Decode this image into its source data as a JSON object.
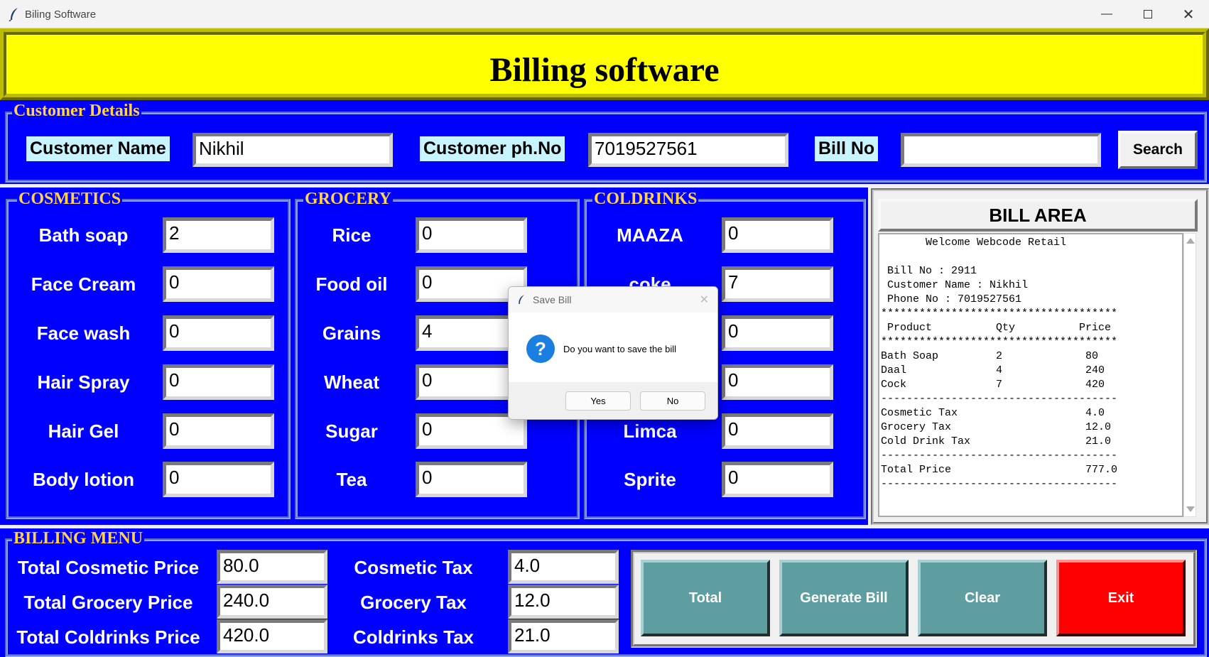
{
  "window": {
    "title": "Biling Software",
    "minimize_icon": "minimize-icon",
    "maximize_icon": "maximize-icon",
    "close_icon": "close-icon"
  },
  "banner": {
    "title": "Billing software"
  },
  "customer": {
    "group_label": "Customer Details",
    "name_label": "Customer Name",
    "name_value": "Nikhil",
    "phone_label": "Customer ph.No",
    "phone_value": "7019527561",
    "billno_label": "Bill No",
    "billno_value": "",
    "search_label": "Search"
  },
  "cosmetics": {
    "group_label": "COSMETICS",
    "items": [
      {
        "label": "Bath soap",
        "value": "2"
      },
      {
        "label": "Face Cream",
        "value": "0"
      },
      {
        "label": "Face wash",
        "value": "0"
      },
      {
        "label": "Hair Spray",
        "value": "0"
      },
      {
        "label": "Hair Gel",
        "value": "0"
      },
      {
        "label": "Body lotion",
        "value": "0"
      }
    ]
  },
  "grocery": {
    "group_label": "GROCERY",
    "items": [
      {
        "label": "Rice",
        "value": "0"
      },
      {
        "label": "Food oil",
        "value": "0"
      },
      {
        "label": "Grains",
        "value": "4"
      },
      {
        "label": "Wheat",
        "value": "0"
      },
      {
        "label": "Sugar",
        "value": "0"
      },
      {
        "label": "Tea",
        "value": "0"
      }
    ]
  },
  "coldrinks": {
    "group_label": "COLDRINKS",
    "items": [
      {
        "label": "MAAZA",
        "value": "0"
      },
      {
        "label": "coke",
        "value": "7"
      },
      {
        "label": "",
        "value": "0"
      },
      {
        "label": "",
        "value": "0"
      },
      {
        "label": "Limca",
        "value": "0"
      },
      {
        "label": "Sprite",
        "value": "0"
      }
    ]
  },
  "bill_area": {
    "title": "BILL AREA",
    "text": "       Welcome Webcode Retail\n\n Bill No : 2911\n Customer Name : Nikhil\n Phone No : 7019527561\n*************************************\n Product          Qty          Price\n*************************************\nBath Soap         2             80\nDaal              4             240\nCock              7             420\n-------------------------------------\nCosmetic Tax                    4.0\nGrocery Tax                     12.0\nCold Drink Tax                  21.0\n-------------------------------------\nTotal Price                     777.0\n-------------------------------------"
  },
  "billing_menu": {
    "group_label": "BILLING MENU",
    "total_cosmetic_label": "Total Cosmetic Price",
    "total_cosmetic_value": "80.0",
    "total_grocery_label": "Total Grocery Price",
    "total_grocery_value": "240.0",
    "total_coldrinks_label": "Total Coldrinks Price",
    "total_coldrinks_value": "420.0",
    "cosmetic_tax_label": "Cosmetic Tax",
    "cosmetic_tax_value": "4.0",
    "grocery_tax_label": "Grocery Tax",
    "grocery_tax_value": "12.0",
    "coldrinks_tax_label": "Coldrinks Tax",
    "coldrinks_tax_value": "21.0",
    "buttons": {
      "total": "Total",
      "generate": "Generate Bill",
      "clear": "Clear",
      "exit": "Exit"
    }
  },
  "dialog": {
    "title": "Save Bill",
    "message": "Do you want to save the bill",
    "icon_glyph": "?",
    "yes": "Yes",
    "no": "No"
  },
  "colors": {
    "banner": "#ffff00",
    "panel": "#0000ff",
    "group_label": "#ffd24a",
    "action_button": "#5f9ea0",
    "exit_button": "#ff0000",
    "label_bg": "#c8f4ff"
  }
}
